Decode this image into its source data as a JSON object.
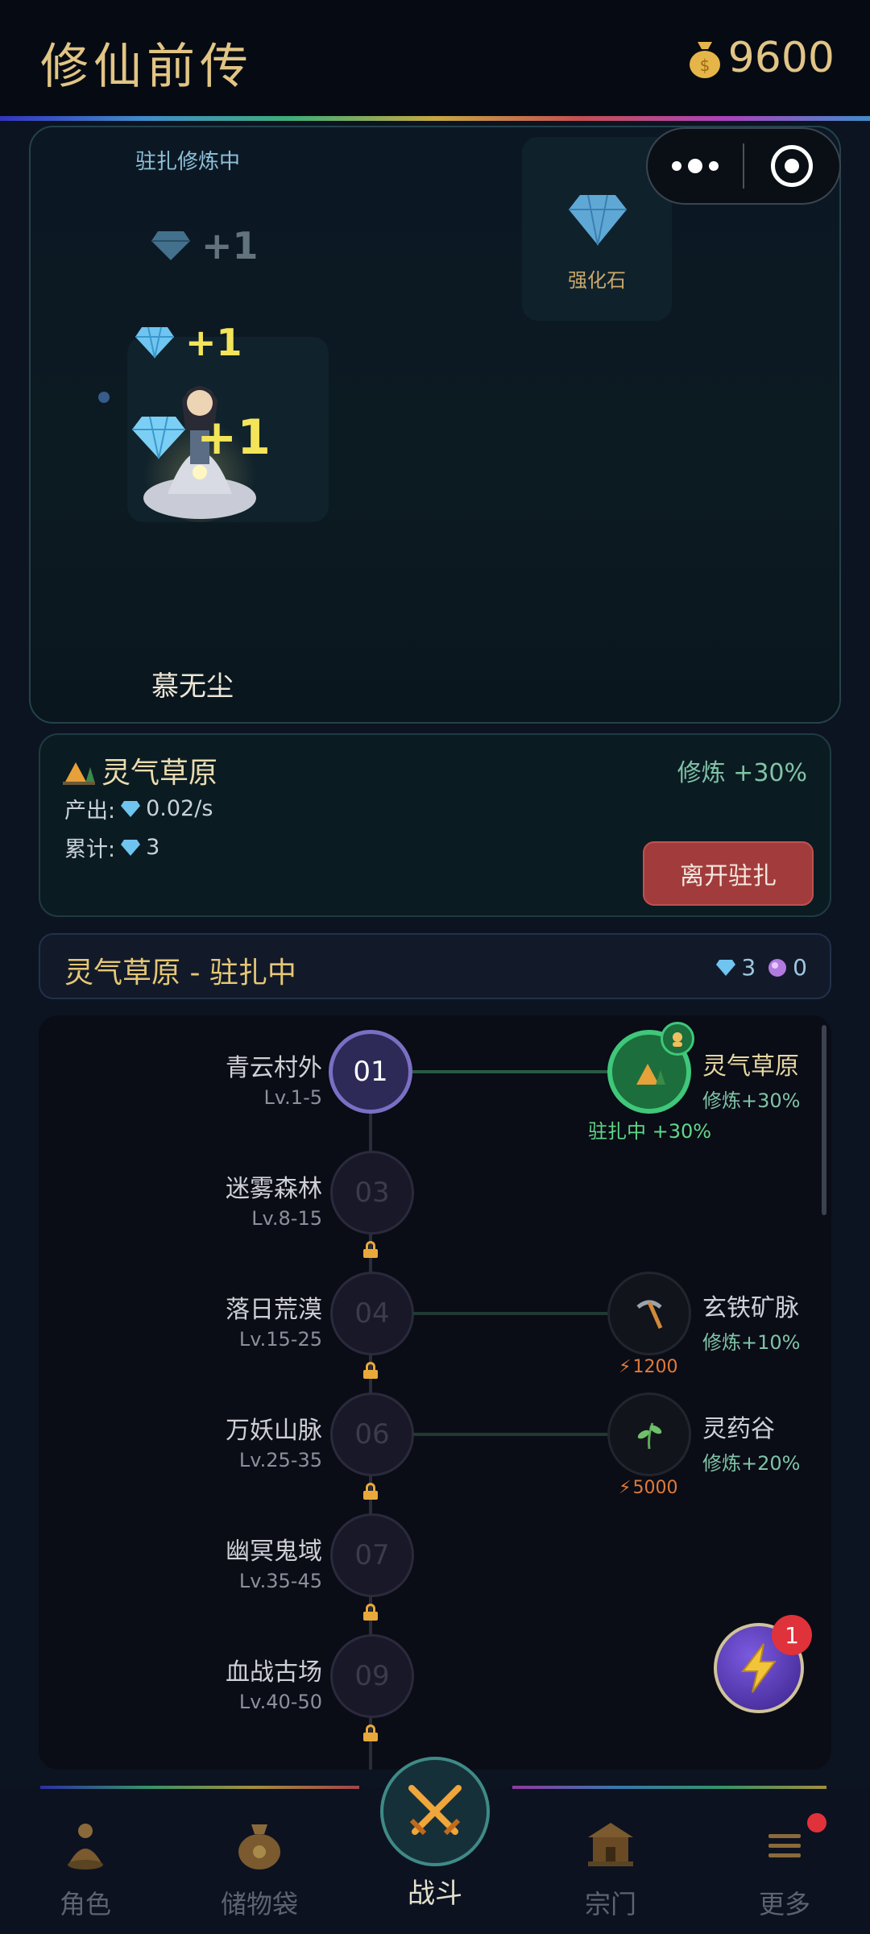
{
  "header": {
    "title": "修仙前传",
    "gold": "9600",
    "gold_icon": "money-bag-icon"
  },
  "top_panel": {
    "status": "驻扎修炼中",
    "character_name": "慕无尘",
    "gains": [
      "+1",
      "+1",
      "+1"
    ],
    "reward_label": "强化石"
  },
  "capsule": {
    "more_icon": "more-dots-icon",
    "close_icon": "target-circle-icon"
  },
  "info": {
    "location": "灵气草原",
    "bonus": "修炼 +30%",
    "yield_label": "产出:",
    "yield_value": "0.02/s",
    "total_label": "累计:",
    "total_value": "3",
    "leave_button": "离开驻扎"
  },
  "status_bar": {
    "text": "灵气草原 - 驻扎中",
    "gems": "3",
    "orbs": "0"
  },
  "stages": [
    {
      "num": "01",
      "name": "青云村外",
      "level": "Lv.1-5",
      "locked": false
    },
    {
      "num": "03",
      "name": "迷雾森林",
      "level": "Lv.8-15",
      "locked": true
    },
    {
      "num": "04",
      "name": "落日荒漠",
      "level": "Lv.15-25",
      "locked": true
    },
    {
      "num": "06",
      "name": "万妖山脉",
      "level": "Lv.25-35",
      "locked": true
    },
    {
      "num": "07",
      "name": "幽冥鬼域",
      "level": "Lv.35-45",
      "locked": true
    },
    {
      "num": "09",
      "name": "血战古场",
      "level": "Lv.40-50",
      "locked": true
    }
  ],
  "spots": [
    {
      "name": "灵气草原",
      "bonus": "修炼+30%",
      "status": "驻扎中 +30%",
      "icon": "camp-tent-icon"
    },
    {
      "name": "玄铁矿脉",
      "bonus": "修炼+10%",
      "cost": "1200",
      "icon": "pickaxe-icon"
    },
    {
      "name": "灵药谷",
      "bonus": "修炼+20%",
      "cost": "5000",
      "icon": "herb-icon"
    }
  ],
  "energy_badge": "1",
  "nav": {
    "role": "角色",
    "bag": "储物袋",
    "battle": "战斗",
    "sect": "宗门",
    "more": "更多"
  }
}
